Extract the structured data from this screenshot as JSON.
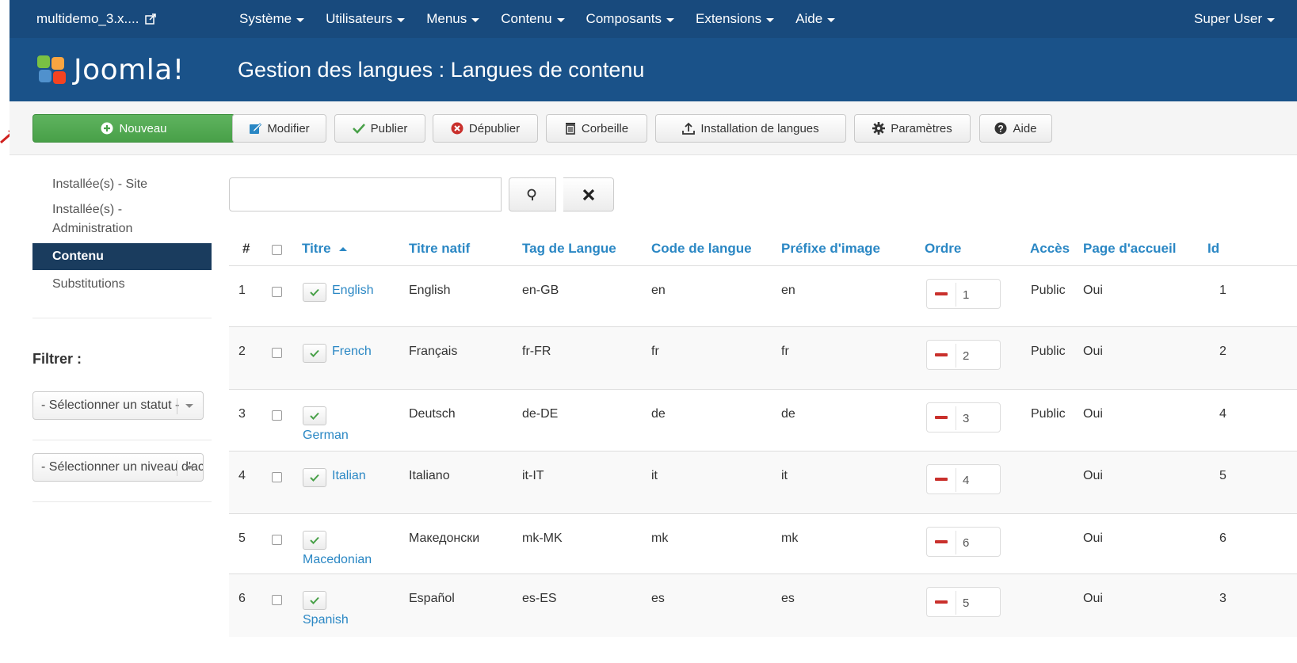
{
  "topbar": {
    "site_name": "multidemo_3.x....",
    "menu": [
      "Système",
      "Utilisateurs",
      "Menus",
      "Contenu",
      "Composants",
      "Extensions",
      "Aide"
    ],
    "user": "Super User"
  },
  "header": {
    "logo_text": "Joomla!",
    "title": "Gestion des langues : Langues de contenu"
  },
  "toolbar": {
    "new": "Nouveau",
    "edit": "Modifier",
    "publish": "Publier",
    "unpublish": "Dépublier",
    "trash": "Corbeille",
    "install": "Installation de langues",
    "options": "Paramètres",
    "help": "Aide"
  },
  "sidebar": {
    "items": [
      {
        "label": "Installée(s) - Site"
      },
      {
        "label": "Installée(s) - Administration"
      },
      {
        "label": "Contenu"
      },
      {
        "label": "Substitutions"
      }
    ],
    "filter_label": "Filtrer :",
    "select1": "- Sélectionner un statut -",
    "select2": "- Sélectionner un niveau d'accès -"
  },
  "search": {
    "value": "",
    "placeholder": ""
  },
  "table": {
    "headers": {
      "num": "#",
      "title": "Titre",
      "native": "Titre natif",
      "tag": "Tag de Langue",
      "code": "Code de langue",
      "prefix": "Préfixe d'image",
      "order": "Ordre",
      "access": "Accès",
      "home": "Page d'accueil",
      "id": "Id"
    },
    "rows": [
      {
        "num": "1",
        "title": "English",
        "native": "English",
        "tag": "en-GB",
        "code": "en",
        "prefix": "en",
        "order": "1",
        "access": "Public",
        "home": "Oui",
        "id": "1"
      },
      {
        "num": "2",
        "title": "French",
        "native": "Français",
        "tag": "fr-FR",
        "code": "fr",
        "prefix": "fr",
        "order": "2",
        "access": "Public",
        "home": "Oui",
        "id": "2"
      },
      {
        "num": "3",
        "title": "German",
        "native": "Deutsch",
        "tag": "de-DE",
        "code": "de",
        "prefix": "de",
        "order": "3",
        "access": "Public",
        "home": "Oui",
        "id": "4"
      },
      {
        "num": "4",
        "title": "Italian",
        "native": "Italiano",
        "tag": "it-IT",
        "code": "it",
        "prefix": "it",
        "order": "4",
        "access": "",
        "home": "Oui",
        "id": "5"
      },
      {
        "num": "5",
        "title": "Macedonian",
        "native": "Македонски",
        "tag": "mk-MK",
        "code": "mk",
        "prefix": "mk",
        "order": "6",
        "access": "",
        "home": "Oui",
        "id": "6"
      },
      {
        "num": "6",
        "title": "Spanish",
        "native": "Español",
        "tag": "es-ES",
        "code": "es",
        "prefix": "es",
        "order": "5",
        "access": "",
        "home": "Oui",
        "id": "3"
      }
    ]
  },
  "colors": {
    "navbar": "#184a7d",
    "header": "#1a5289",
    "link": "#2a87c4",
    "new_button": "#51a351",
    "active_sidebar": "#1a3c5e"
  }
}
